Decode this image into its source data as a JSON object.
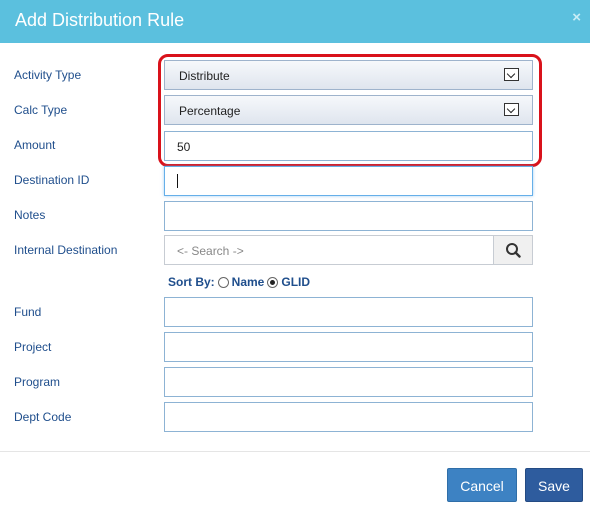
{
  "dialog": {
    "title": "Add Distribution Rule",
    "close_glyph": "×"
  },
  "form": {
    "activity_type": {
      "label": "Activity Type",
      "value": "Distribute"
    },
    "calc_type": {
      "label": "Calc Type",
      "value": "Percentage"
    },
    "amount": {
      "label": "Amount",
      "value": "50"
    },
    "destination_id": {
      "label": "Destination ID",
      "value": ""
    },
    "notes": {
      "label": "Notes",
      "value": ""
    },
    "internal_destination": {
      "label": "Internal Destination",
      "placeholder": "<- Search ->"
    },
    "sort_by": {
      "label": "Sort By:",
      "options": [
        "Name",
        "GLID"
      ],
      "selected": "GLID"
    },
    "fund": {
      "label": "Fund",
      "value": ""
    },
    "project": {
      "label": "Project",
      "value": ""
    },
    "program": {
      "label": "Program",
      "value": ""
    },
    "dept_code": {
      "label": "Dept Code",
      "value": ""
    }
  },
  "buttons": {
    "cancel": "Cancel",
    "save": "Save"
  },
  "colors": {
    "header": "#5bc0de",
    "label": "#1f4e8c",
    "highlight": "#d9121b",
    "save": "#2e5c9e",
    "cancel": "#3d82c3"
  }
}
